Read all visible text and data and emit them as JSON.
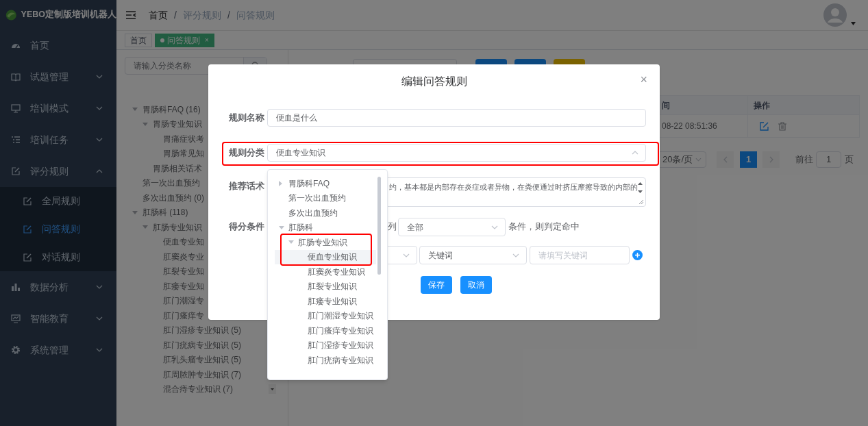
{
  "sidebar": {
    "brand": "YEBO定制版培训机器人",
    "menu": [
      {
        "label": "首页"
      },
      {
        "label": "试题管理",
        "expanded": false
      },
      {
        "label": "培训模式",
        "expanded": false
      },
      {
        "label": "培训任务",
        "expanded": false
      },
      {
        "label": "评分规则",
        "expanded": true,
        "children": [
          {
            "label": "全局规则",
            "selected": false
          },
          {
            "label": "问答规则",
            "selected": true
          },
          {
            "label": "对话规则",
            "selected": false
          }
        ]
      },
      {
        "label": "数据分析",
        "expanded": false
      },
      {
        "label": "智能教育",
        "expanded": false
      },
      {
        "label": "系统管理",
        "expanded": false
      }
    ]
  },
  "header": {
    "breadcrumb": [
      {
        "label": "首页",
        "link": true
      },
      {
        "label": "评分规则",
        "link": false
      },
      {
        "label": "问答规则",
        "link": false
      }
    ],
    "separators": [
      "/",
      "/"
    ]
  },
  "tags": [
    {
      "label": "首页",
      "selected": false
    },
    {
      "label": "问答规则",
      "selected": true,
      "close": "×"
    }
  ],
  "category_panel": {
    "search_placeholder": "请输入分类名称",
    "tree": [
      {
        "label": "胃肠科FAQ (16)",
        "expanded": true,
        "children": [
          {
            "label": "胃肠专业知识",
            "expanded": true,
            "children": [
              {
                "label": "胃痛症状考"
              },
              {
                "label": "胃肠常见知"
              }
            ]
          },
          {
            "label": "胃肠相关话术"
          }
        ]
      },
      {
        "label": "第一次出血预约"
      },
      {
        "label": "多次出血预约 (0)"
      },
      {
        "label": "肛肠科 (118)",
        "expanded": true,
        "children": [
          {
            "label": "肛肠专业知识",
            "expanded": true,
            "children": [
              {
                "label": "便血专业知"
              },
              {
                "label": "肛窦炎专业"
              },
              {
                "label": "肛裂专业知"
              },
              {
                "label": "肛瘘专业知"
              },
              {
                "label": "肛门潮湿专"
              },
              {
                "label": "肛门瘙痒专"
              },
              {
                "label": "肛门湿疹专业知识 (5)"
              },
              {
                "label": "肛门疣病专业知识 (5)"
              },
              {
                "label": "肛乳头瘤专业知识 (5)"
              },
              {
                "label": "肛周脓肿专业知识 (7)"
              },
              {
                "label": "混合痔专业知识 (7)"
              }
            ]
          }
        ]
      }
    ]
  },
  "rules_panel": {
    "toolbar_buttons": [
      {
        "kind": "primary"
      },
      {
        "kind": "primary"
      },
      {
        "kind": "warning"
      }
    ],
    "columns": [
      "间",
      "操作"
    ],
    "rows": [
      {
        "time": "08-22 08:51:36"
      }
    ],
    "pagination": {
      "page_size": "20条/页",
      "pages": [
        {
          "label": "1",
          "selected": true
        }
      ],
      "goto_label": "前往",
      "goto_value": "1",
      "goto_suffix": "页"
    }
  },
  "dialog": {
    "title": "编辑问答规则",
    "close": "×",
    "fields": [
      {
        "kind": "input",
        "label": "规则名称",
        "value": "便血是什么"
      },
      {
        "kind": "select",
        "label": "规则分类",
        "value": "便血专业知识",
        "open": true,
        "highlighted": true
      },
      {
        "kind": "textarea",
        "label": "推荐话术",
        "value": "约，基本都是内部存在炎症或者异物，在粪便通过时挤压摩擦导致的内部的"
      }
    ],
    "score": {
      "label": "得分条件",
      "prefix": "列",
      "match": "全部",
      "suffix": "条件，则判定命中",
      "rules": [
        {
          "type": "关键词",
          "placeholder": "请填写关键词"
        }
      ]
    },
    "buttons": [
      {
        "label": "保存"
      },
      {
        "label": "取消"
      }
    ]
  },
  "category_dropdown": {
    "tree": [
      {
        "label": "胃肠科FAQ",
        "expanded": false,
        "selected": false,
        "highlighted": false
      },
      {
        "label": "第一次出血预约",
        "selected": false,
        "highlighted": false
      },
      {
        "label": "多次出血预约",
        "selected": false,
        "highlighted": false
      },
      {
        "label": "肛肠科",
        "expanded": true,
        "selected": false,
        "highlighted": false,
        "children": [
          {
            "label": "肛肠专业知识",
            "expanded": true,
            "selected": false,
            "highlighted": true,
            "children": [
              {
                "label": "便血专业知识",
                "selected": true,
                "highlighted": true
              },
              {
                "label": "肛窦炎专业知识",
                "selected": false,
                "highlighted": false
              },
              {
                "label": "肛裂专业知识",
                "selected": false,
                "highlighted": false
              },
              {
                "label": "肛瘘专业知识",
                "selected": false,
                "highlighted": false
              },
              {
                "label": "肛门潮湿专业知识",
                "selected": false,
                "highlighted": false
              },
              {
                "label": "肛门瘙痒专业知识",
                "selected": false,
                "highlighted": false
              },
              {
                "label": "肛门湿疹专业知识",
                "selected": false,
                "highlighted": false
              },
              {
                "label": "肛门疣病专业知识",
                "selected": false,
                "highlighted": false
              }
            ]
          }
        ]
      }
    ]
  }
}
